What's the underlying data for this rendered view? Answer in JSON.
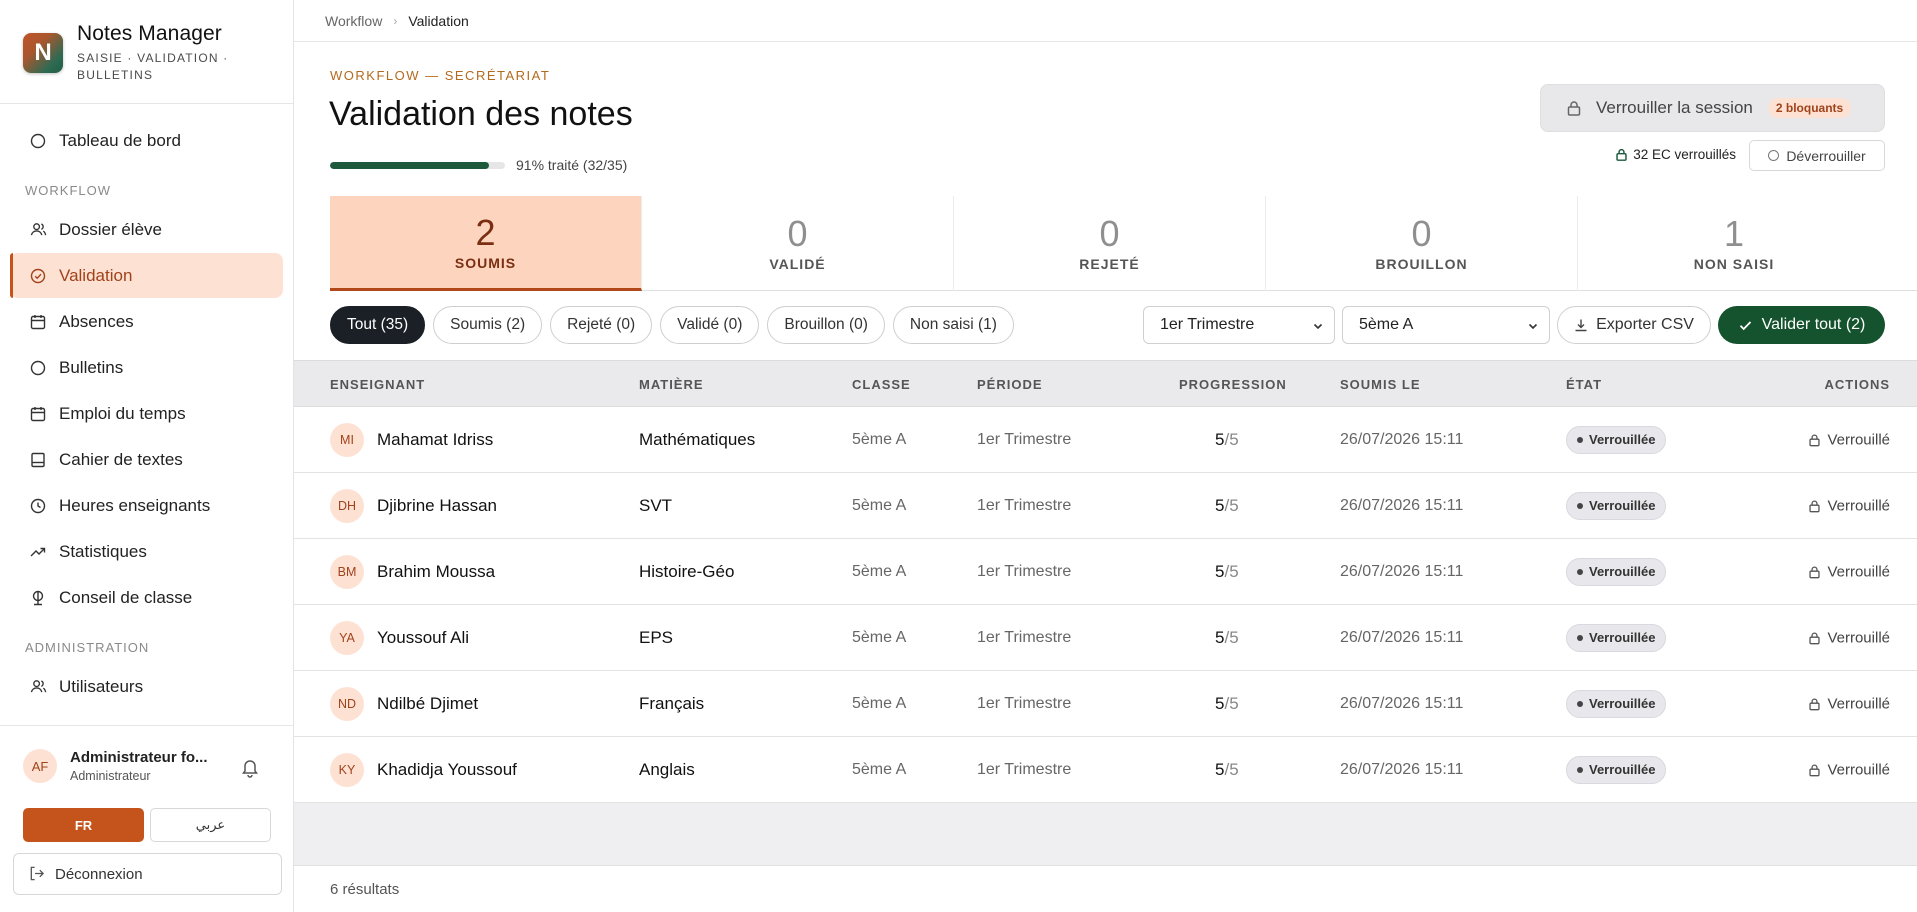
{
  "app": {
    "title": "Notes Manager",
    "subtitle": "SAISIE · VALIDATION · BULLETINS",
    "logo_letter": "N"
  },
  "sidebar": {
    "top_item": "Tableau de bord",
    "workflow_label": "WORKFLOW",
    "workflow_items": [
      {
        "label": "Dossier élève",
        "icon": "users-icon"
      },
      {
        "label": "Validation",
        "icon": "check-circle-icon",
        "active": true
      },
      {
        "label": "Absences",
        "icon": "calendar-icon"
      },
      {
        "label": "Bulletins",
        "icon": "circle-icon"
      },
      {
        "label": "Emploi du temps",
        "icon": "calendar-icon"
      },
      {
        "label": "Cahier de textes",
        "icon": "book-icon"
      },
      {
        "label": "Heures enseignants",
        "icon": "clock-icon"
      },
      {
        "label": "Statistiques",
        "icon": "trending-up-icon"
      },
      {
        "label": "Conseil de classe",
        "icon": "scale-icon"
      }
    ],
    "admin_label": "ADMINISTRATION",
    "admin_items": [
      {
        "label": "Utilisateurs",
        "icon": "users-icon"
      }
    ]
  },
  "user": {
    "initials": "AF",
    "name": "Administrateur fo...",
    "role": "Administrateur",
    "lang_fr": "FR",
    "lang_ar": "عربي",
    "logout": "Déconnexion"
  },
  "breadcrumb": {
    "root": "Workflow",
    "current": "Validation"
  },
  "header": {
    "eyebrow": "WORKFLOW — SECRÉTARIAT",
    "title": "Validation des notes",
    "progress_text": "91% traité (32/35)",
    "progress_fraction": 0.91,
    "lock_button": "Verrouiller la session",
    "blocking_badge": "2 bloquants",
    "locked_info": "32 EC verrouillés",
    "unlock_button": "Déverrouiller"
  },
  "stats": [
    {
      "value": "2",
      "label": "SOUMIS",
      "active": true
    },
    {
      "value": "0",
      "label": "VALIDÉ"
    },
    {
      "value": "0",
      "label": "REJETÉ"
    },
    {
      "value": "0",
      "label": "BROUILLON"
    },
    {
      "value": "1",
      "label": "NON SAISI"
    }
  ],
  "filters": [
    {
      "label": "Tout (35)",
      "active": true
    },
    {
      "label": "Soumis (2)"
    },
    {
      "label": "Rejeté (0)"
    },
    {
      "label": "Validé (0)"
    },
    {
      "label": "Brouillon (0)"
    },
    {
      "label": "Non saisi (1)"
    }
  ],
  "controls": {
    "period_select": "1er Trimestre",
    "class_select": "5ème A",
    "export": "Exporter CSV",
    "validate_all": "Valider tout (2)"
  },
  "table": {
    "headers": [
      "ENSEIGNANT",
      "MATIÈRE",
      "CLASSE",
      "PÉRIODE",
      "PROGRESSION",
      "SOUMIS LE",
      "ÉTAT",
      "ACTIONS"
    ],
    "rows": [
      {
        "initials": "MI",
        "teacher": "Mahamat Idriss",
        "subject": "Mathématiques",
        "class": "5ème A",
        "period": "1er Trimestre",
        "done": "5",
        "total": "/5",
        "submitted": "26/07/2026 15:11",
        "state": "Verrouillée",
        "action": "Verrouillé"
      },
      {
        "initials": "DH",
        "teacher": "Djibrine Hassan",
        "subject": "SVT",
        "class": "5ème A",
        "period": "1er Trimestre",
        "done": "5",
        "total": "/5",
        "submitted": "26/07/2026 15:11",
        "state": "Verrouillée",
        "action": "Verrouillé"
      },
      {
        "initials": "BM",
        "teacher": "Brahim Moussa",
        "subject": "Histoire-Géo",
        "class": "5ème A",
        "period": "1er Trimestre",
        "done": "5",
        "total": "/5",
        "submitted": "26/07/2026 15:11",
        "state": "Verrouillée",
        "action": "Verrouillé"
      },
      {
        "initials": "YA",
        "teacher": "Youssouf Ali",
        "subject": "EPS",
        "class": "5ème A",
        "period": "1er Trimestre",
        "done": "5",
        "total": "/5",
        "submitted": "26/07/2026 15:11",
        "state": "Verrouillée",
        "action": "Verrouillé"
      },
      {
        "initials": "ND",
        "teacher": "Ndilbé Djimet",
        "subject": "Français",
        "class": "5ème A",
        "period": "1er Trimestre",
        "done": "5",
        "total": "/5",
        "submitted": "26/07/2026 15:11",
        "state": "Verrouillée",
        "action": "Verrouillé"
      },
      {
        "initials": "KY",
        "teacher": "Khadidja Youssouf",
        "subject": "Anglais",
        "class": "5ème A",
        "period": "1er Trimestre",
        "done": "5",
        "total": "/5",
        "submitted": "26/07/2026 15:11",
        "state": "Verrouillée",
        "action": "Verrouillé"
      }
    ]
  },
  "footer": {
    "results": "6 résultats"
  }
}
